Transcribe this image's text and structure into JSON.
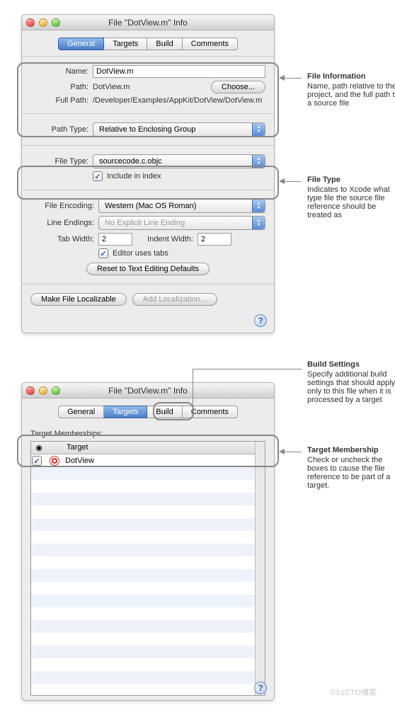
{
  "window1": {
    "title": "File \"DotView.m\" Info",
    "tabs": {
      "general": "General",
      "targets": "Targets",
      "build": "Build",
      "comments": "Comments"
    },
    "name_label": "Name:",
    "name_value": "DotView.m",
    "path_label": "Path:",
    "path_value": "DotView.m",
    "choose": "Choose...",
    "fullpath_label": "Full Path:",
    "fullpath_value": "/Developer/Examples/AppKit/DotView/DotView.m",
    "pathtype_label": "Path Type:",
    "pathtype_value": "Relative to Enclosing Group",
    "filetype_label": "File Type:",
    "filetype_value": "sourcecode.c.objc",
    "include_in_index": "Include in index",
    "fileencoding_label": "File Encoding:",
    "fileencoding_value": "Western (Mac OS Roman)",
    "lineendings_label": "Line Endings:",
    "lineendings_value": "No Explicit Line Ending",
    "tabwidth_label": "Tab Width:",
    "tabwidth_value": "2",
    "indentwidth_label": "Indent Width:",
    "indentwidth_value": "2",
    "editor_uses_tabs": "Editor uses tabs",
    "reset": "Reset to Text Editing Defaults",
    "make_localizable": "Make File Localizable",
    "add_localization": "Add Localization..."
  },
  "window2": {
    "title": "File \"DotView.m\" Info",
    "tabs": {
      "general": "General",
      "targets": "Targets",
      "build": "Build",
      "comments": "Comments"
    },
    "memberships_label": "Target Memberships:",
    "col_check": "◉",
    "col_target": "Target",
    "row_name": "DotView"
  },
  "annotations": {
    "a1_title": "File Information",
    "a1_body": "Name, path relative to the project, and the full path to a source file",
    "a2_title": "File Type",
    "a2_body": "Indicates to Xcode what type file the source file reference should be treated as",
    "a3_title": "Build Settings",
    "a3_body": "Specify additional build settings that should apply only to this file when it is processed by a target",
    "a4_title": "Target Membership",
    "a4_body": "Check or uncheck the boxes to cause the file reference to be part of a target."
  },
  "watermark": "©51CTO博客"
}
